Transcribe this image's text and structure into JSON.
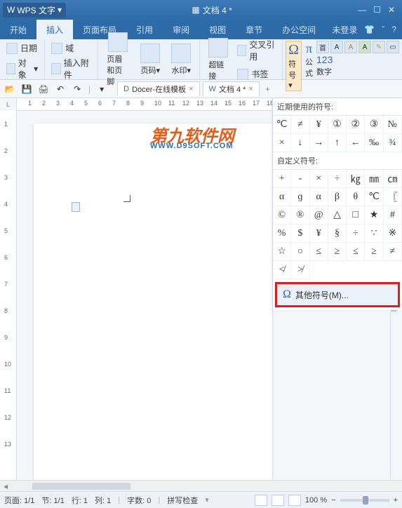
{
  "titlebar": {
    "app_name": "WPS 文字",
    "doc_title": "文档 4 *"
  },
  "menu": {
    "tabs": [
      "开始",
      "插入",
      "页面布局",
      "引用",
      "审阅",
      "视图",
      "章节",
      "办公空间"
    ],
    "active_index": 1,
    "not_logged": "未登录"
  },
  "ribbon": {
    "g1": {
      "date": "日期",
      "field": "域",
      "object": "对象",
      "attach": "插入附件"
    },
    "g2": {
      "header_footer": "页眉和页脚",
      "page_num": "页码",
      "watermark": "水印"
    },
    "g3": {
      "hyperlink": "超链接",
      "crossref": "交叉引用",
      "bookmark": "书签"
    },
    "g4": {
      "symbol": "符号",
      "pi": "公式",
      "number": "数字"
    }
  },
  "doctabs": {
    "tab1": "Docer-在线模板",
    "tab2": "文档 4 *"
  },
  "symbol_panel": {
    "recent_label": "近期使用的符号:",
    "custom_label": "自定义符号:",
    "recent": [
      "℃",
      "≠",
      "¥",
      "①",
      "②",
      "③",
      "№",
      "×",
      "↓",
      "→",
      "↑",
      "←",
      "‰",
      "¾"
    ],
    "custom": [
      "+",
      "-",
      "×",
      "÷",
      "㎏",
      "㎜",
      "㎝",
      "α",
      "ɡ",
      "α",
      "β",
      "θ",
      "℃",
      "〖",
      "©",
      "®",
      "@",
      "△",
      "□",
      "★",
      "#",
      "%",
      "$",
      "¥",
      "§",
      "÷",
      "∵",
      "※",
      "☆",
      "○",
      "≤",
      "≥",
      "≤",
      "≥",
      "≠",
      "≮",
      "≯"
    ],
    "more": "其他符号(M)..."
  },
  "side": {
    "backup": "备份"
  },
  "watermark": {
    "line1": "第九软件网",
    "line2": "WWW.D9SOFT.COM"
  },
  "status": {
    "page": "页面: 1/1",
    "section": "节: 1/1",
    "row": "行: 1",
    "col": "列: 1",
    "chars_label": "字数: 0",
    "spellcheck": "拼写检查",
    "zoom": "100 %"
  },
  "ruler": {
    "h": [
      "1",
      "2",
      "3",
      "4",
      "5",
      "6",
      "7",
      "8",
      "9",
      "10",
      "11",
      "12",
      "13",
      "14",
      "15",
      "16",
      "17",
      "18"
    ],
    "v": [
      "1",
      "2",
      "3",
      "4",
      "5",
      "6",
      "7",
      "8",
      "9",
      "10",
      "11",
      "12",
      "13"
    ]
  }
}
